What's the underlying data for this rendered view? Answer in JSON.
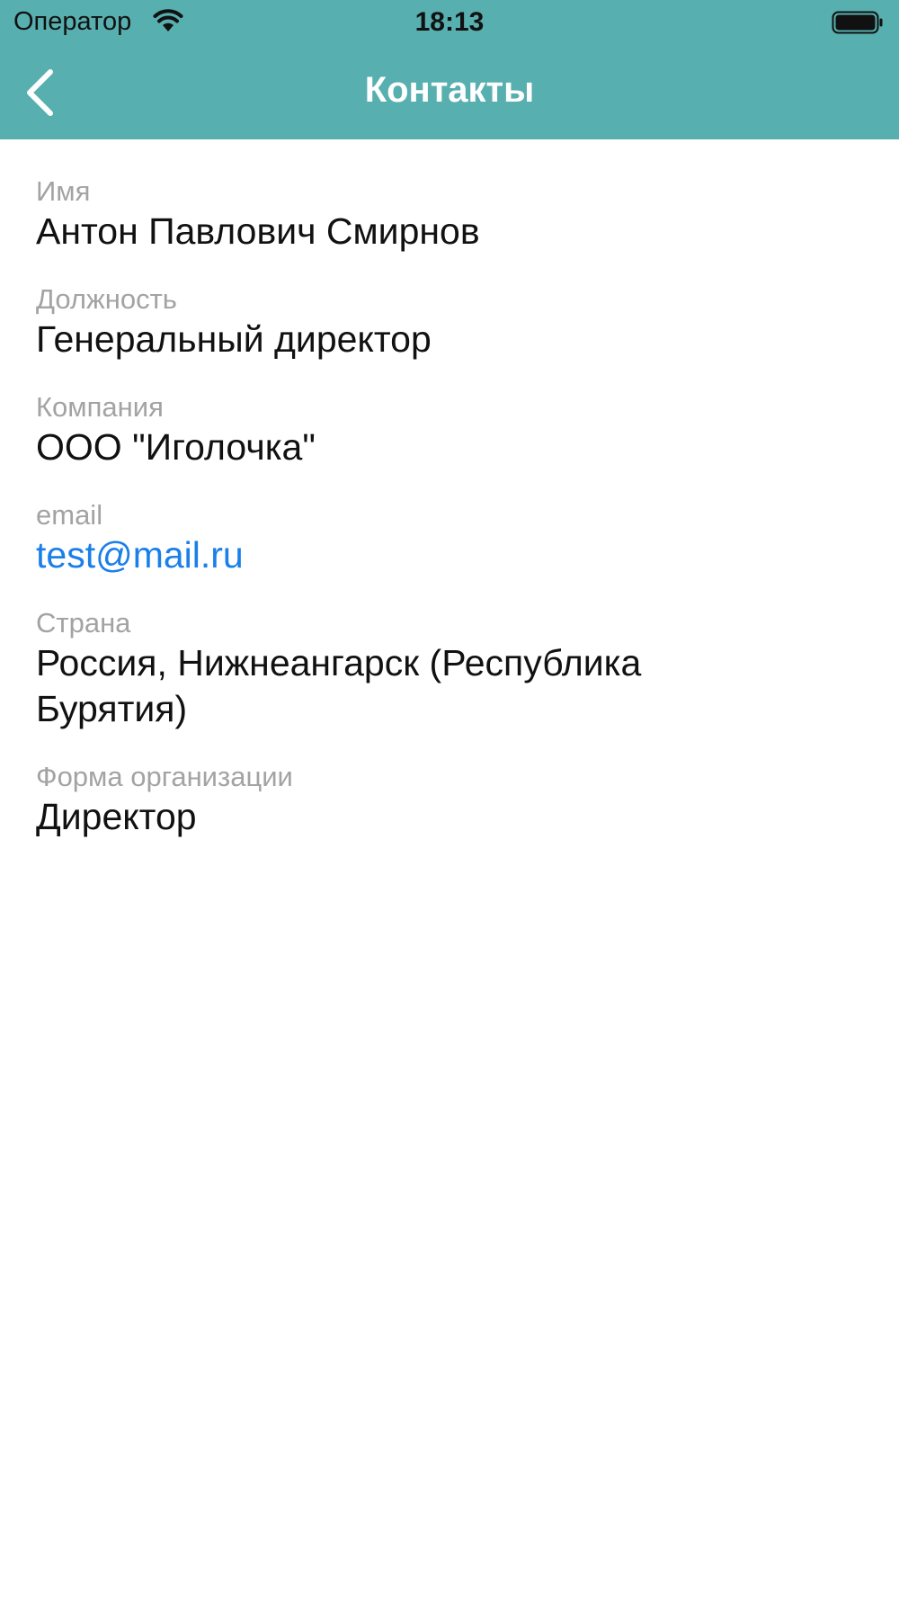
{
  "status_bar": {
    "carrier": "Оператор",
    "time": "18:13",
    "wifi_icon": "wifi-icon",
    "battery_icon": "battery-icon"
  },
  "nav": {
    "title": "Контакты",
    "back_icon": "chevron-left-icon",
    "background_color": "#58afaf"
  },
  "contact": {
    "fields": [
      {
        "label": "Имя",
        "value": "Антон Павлович Смирнов"
      },
      {
        "label": "Должность",
        "value": "Генеральный директор"
      },
      {
        "label": "Компания",
        "value": "ООО \"Иголочка\""
      },
      {
        "label": "email",
        "value": "test@mail.ru"
      },
      {
        "label": "Страна",
        "value": "Россия, Нижнеангарск (Республика Бурятия)"
      },
      {
        "label": "Форма организации",
        "value": "Директор"
      }
    ]
  },
  "colors": {
    "accent": "#58afaf",
    "link": "#1a7fe8",
    "label": "#a3a3a3",
    "text": "#111111"
  }
}
